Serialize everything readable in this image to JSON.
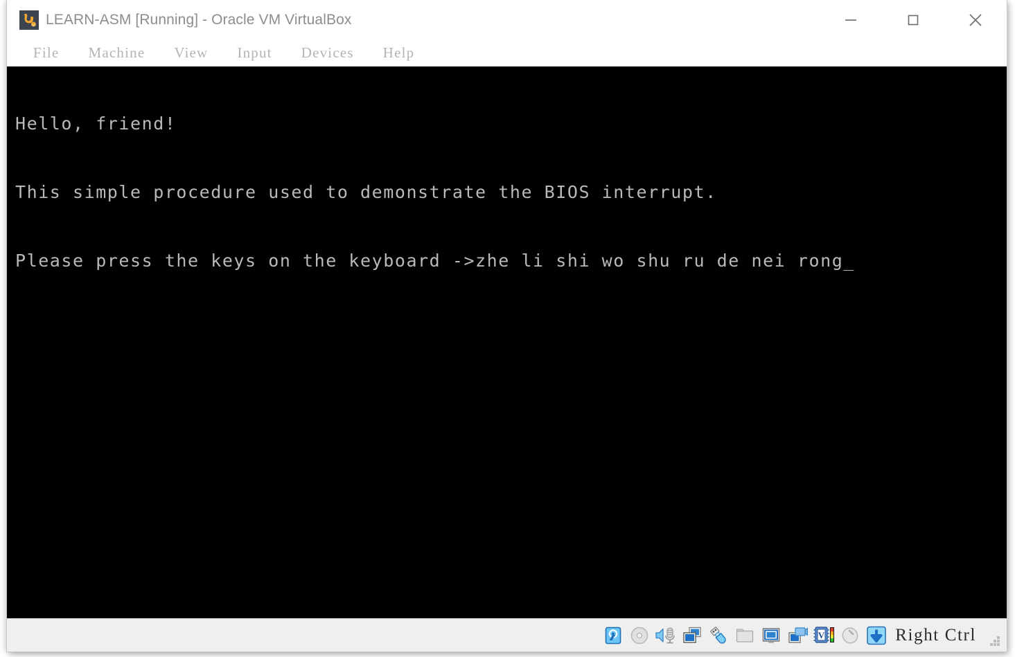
{
  "window": {
    "title": "LEARN-ASM [Running] - Oracle VM VirtualBox",
    "app_icon": "virtualbox-logo-icon",
    "controls": {
      "minimize": "minimize-icon",
      "maximize": "maximize-icon",
      "close": "close-icon"
    }
  },
  "menubar": {
    "items": [
      {
        "label": "File"
      },
      {
        "label": "Machine"
      },
      {
        "label": "View"
      },
      {
        "label": "Input"
      },
      {
        "label": "Devices"
      },
      {
        "label": "Help"
      }
    ]
  },
  "guest_screen": {
    "background_color": "#000000",
    "text_color": "#b9b9b9",
    "lines": [
      "Hello, friend!",
      "This simple procedure used to demonstrate the BIOS interrupt.",
      "Please press the keys on the keyboard ->zhe li shi wo shu ru de nei rong_"
    ]
  },
  "statusbar": {
    "icons": [
      {
        "name": "hard-disk-icon",
        "state": "active"
      },
      {
        "name": "optical-disc-icon",
        "state": "inactive"
      },
      {
        "name": "audio-icon",
        "state": "active"
      },
      {
        "name": "network-icon",
        "state": "active"
      },
      {
        "name": "usb-icon",
        "state": "active"
      },
      {
        "name": "shared-folders-icon",
        "state": "inactive"
      },
      {
        "name": "display-icon",
        "state": "active"
      },
      {
        "name": "video-capture-icon",
        "state": "active"
      },
      {
        "name": "virtualization-chip-icon",
        "state": "active"
      },
      {
        "name": "mouse-integration-icon",
        "state": "inactive"
      },
      {
        "name": "host-key-icon",
        "state": "active"
      }
    ],
    "host_key_label": "Right Ctrl",
    "resize_grip": "resize-grip-icon"
  },
  "colors": {
    "accent_blue": "#2a7fd4",
    "icon_blue": "#1d6fc4",
    "title_text": "#8d8d8d",
    "menu_text": "#b4b4b4",
    "statusbar_bg": "#efefef"
  }
}
